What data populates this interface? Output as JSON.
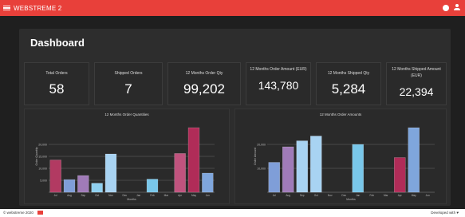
{
  "app": {
    "title": "WEBSTREME 2"
  },
  "page": {
    "title": "Dashboard"
  },
  "cards": [
    {
      "label": "Total Orders",
      "value": "58"
    },
    {
      "label": "Shipped Orders",
      "value": "7"
    },
    {
      "label": "12 Months Order Qty",
      "value": "99,202"
    },
    {
      "label": "12 Months Order Amount (EUR)",
      "value": "143,780"
    },
    {
      "label": "12 Months Shipped Qty",
      "value": "5,284"
    },
    {
      "label": "12 Months Shipped Amount (EUR)",
      "value": "22,394"
    }
  ],
  "footer": {
    "copyright": "© webstreme 2020",
    "brand": "webstreme",
    "developed": "Developed with ♥"
  },
  "colors": {
    "accent": "#e8403a",
    "background": "#1f1f1f",
    "panel": "#2d2d2d"
  },
  "chart_data": [
    {
      "type": "bar",
      "title": "12 Months Order Quantities",
      "xlabel": "Months",
      "ylabel": "Order Quantity",
      "categories": [
        "Jul",
        "Aug",
        "Sep",
        "Oct",
        "Nov",
        "Dec",
        "Jan",
        "Feb",
        "Mar",
        "Apr",
        "May",
        "Jun"
      ],
      "values": [
        13500,
        5300,
        7000,
        3800,
        16000,
        0,
        0,
        5500,
        0,
        16200,
        27000,
        8000
      ],
      "colors": [
        "#b23a62",
        "#7f9ed8",
        "#a07bb8",
        "#8fd0f0",
        "#a8d3f2",
        "#7fb2e0",
        "#7fb2e0",
        "#79c7ea",
        "#7fb2e0",
        "#c0537e",
        "#b02c58",
        "#7fa6dc"
      ],
      "ylim": [
        0,
        30000
      ],
      "yticks": [
        "5,000",
        "10,000",
        "15,000",
        "20,000"
      ]
    },
    {
      "type": "bar",
      "title": "12 Months Order Amounts",
      "xlabel": "Months",
      "ylabel": "Order Amount",
      "categories": [
        "Jul",
        "Aug",
        "Sep",
        "Oct",
        "Nov",
        "Dec",
        "Jan",
        "Feb",
        "Mar",
        "Apr",
        "May",
        "Jun"
      ],
      "values": [
        12500,
        19000,
        21500,
        23500,
        0,
        0,
        20000,
        0,
        0,
        14500,
        27000,
        0
      ],
      "colors": [
        "#7f9ed8",
        "#a07bb8",
        "#a8d3f2",
        "#a8d3f2",
        "#7fb2e0",
        "#7fb2e0",
        "#79c7ea",
        "#7fb2e0",
        "#7fb2e0",
        "#b02c58",
        "#7fa6dc",
        "#7fb2e0"
      ],
      "ylim": [
        0,
        30000
      ],
      "yticks": [
        "10,000",
        "20,000"
      ]
    }
  ]
}
